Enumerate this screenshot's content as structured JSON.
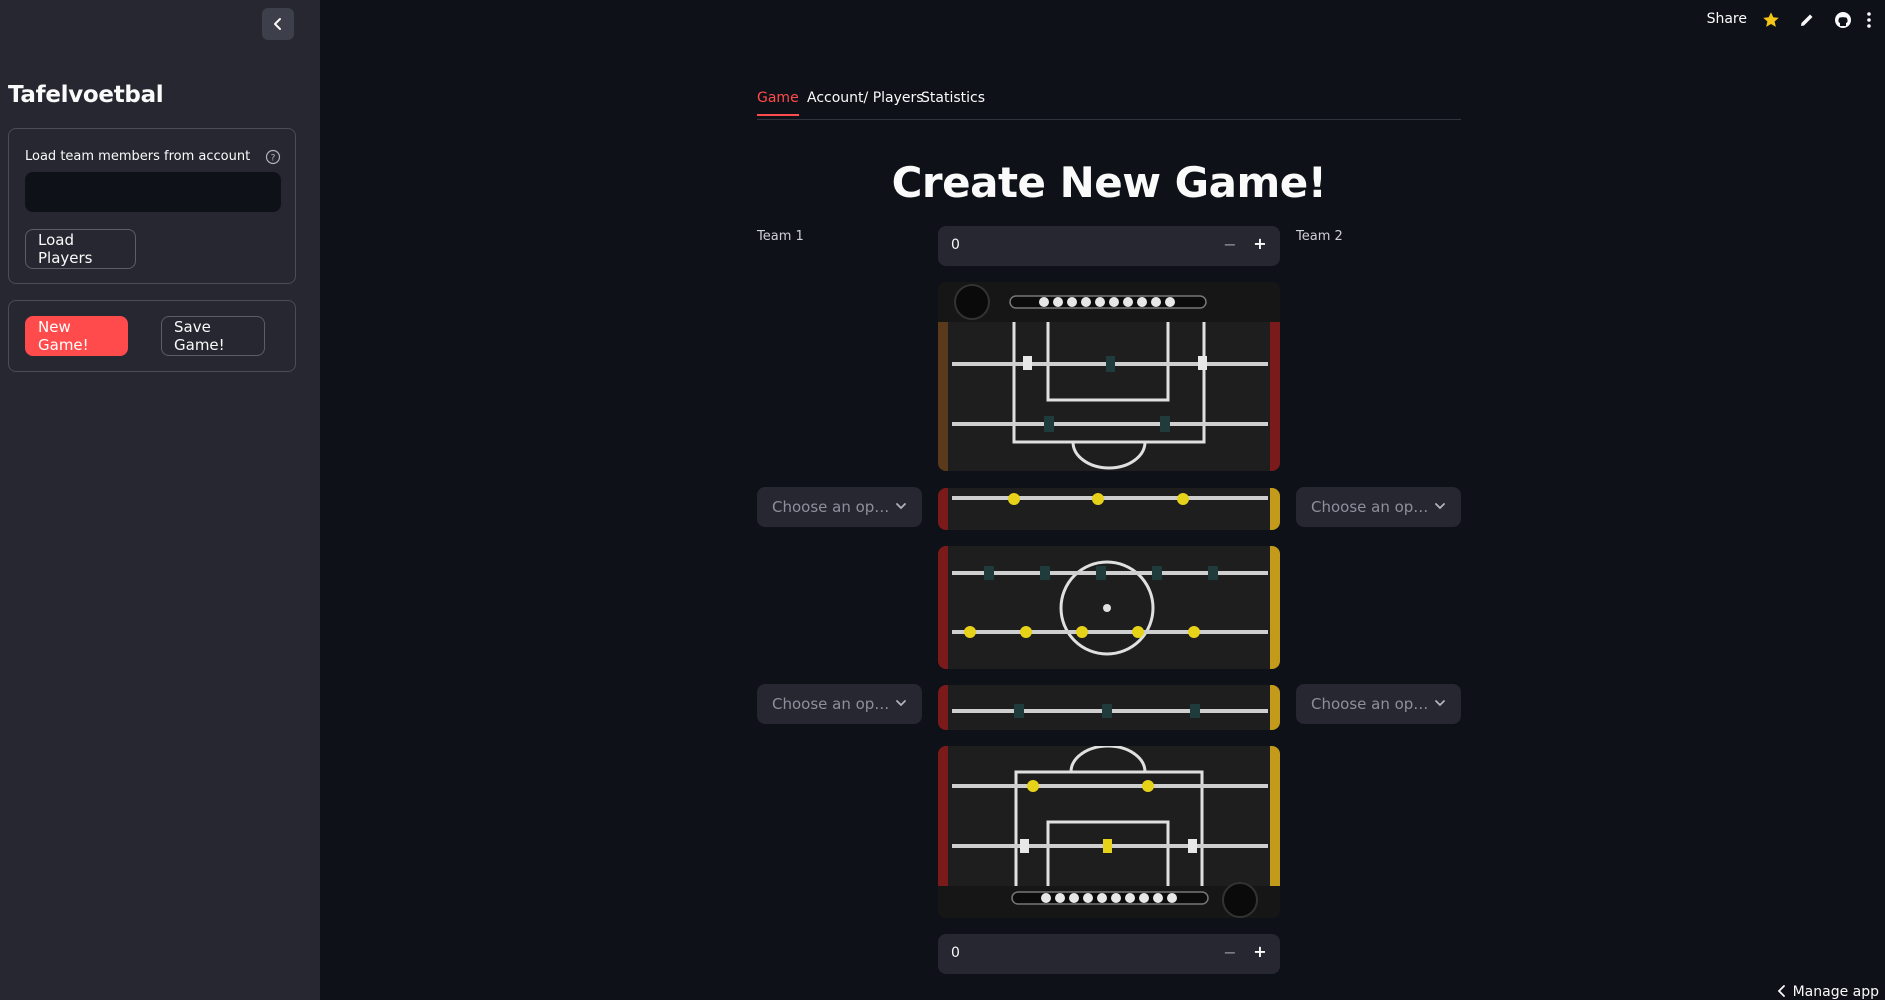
{
  "sidebar": {
    "title": "Tafelvoetbal",
    "load_box": {
      "label": "Load team members from account",
      "input_value": "",
      "load_button": "Load Players"
    },
    "new_game_button": "New Game!",
    "save_game_button": "Save Game!"
  },
  "topbar": {
    "share": "Share"
  },
  "tabs": [
    {
      "label": "Game",
      "active": true
    },
    {
      "label": "Account/ Players",
      "active": false
    },
    {
      "label": "Statistics",
      "active": false
    }
  ],
  "main": {
    "title": "Create New Game!",
    "team1_label": "Team 1",
    "team2_label": "Team 2",
    "score_top": "0",
    "score_bottom": "0",
    "selects": {
      "team1_player1": "Choose an op…",
      "team2_player1": "Choose an op…",
      "team1_player2": "Choose an op…",
      "team2_player2": "Choose an op…"
    }
  },
  "footer": {
    "manage_app": "Manage app"
  },
  "colors": {
    "accent": "#ff4b4b",
    "background": "#0e1117",
    "sidebar": "#262730",
    "star": "#f5c518",
    "team_yellow": "#e7d21a",
    "team_dark": "#1f3b3b"
  }
}
